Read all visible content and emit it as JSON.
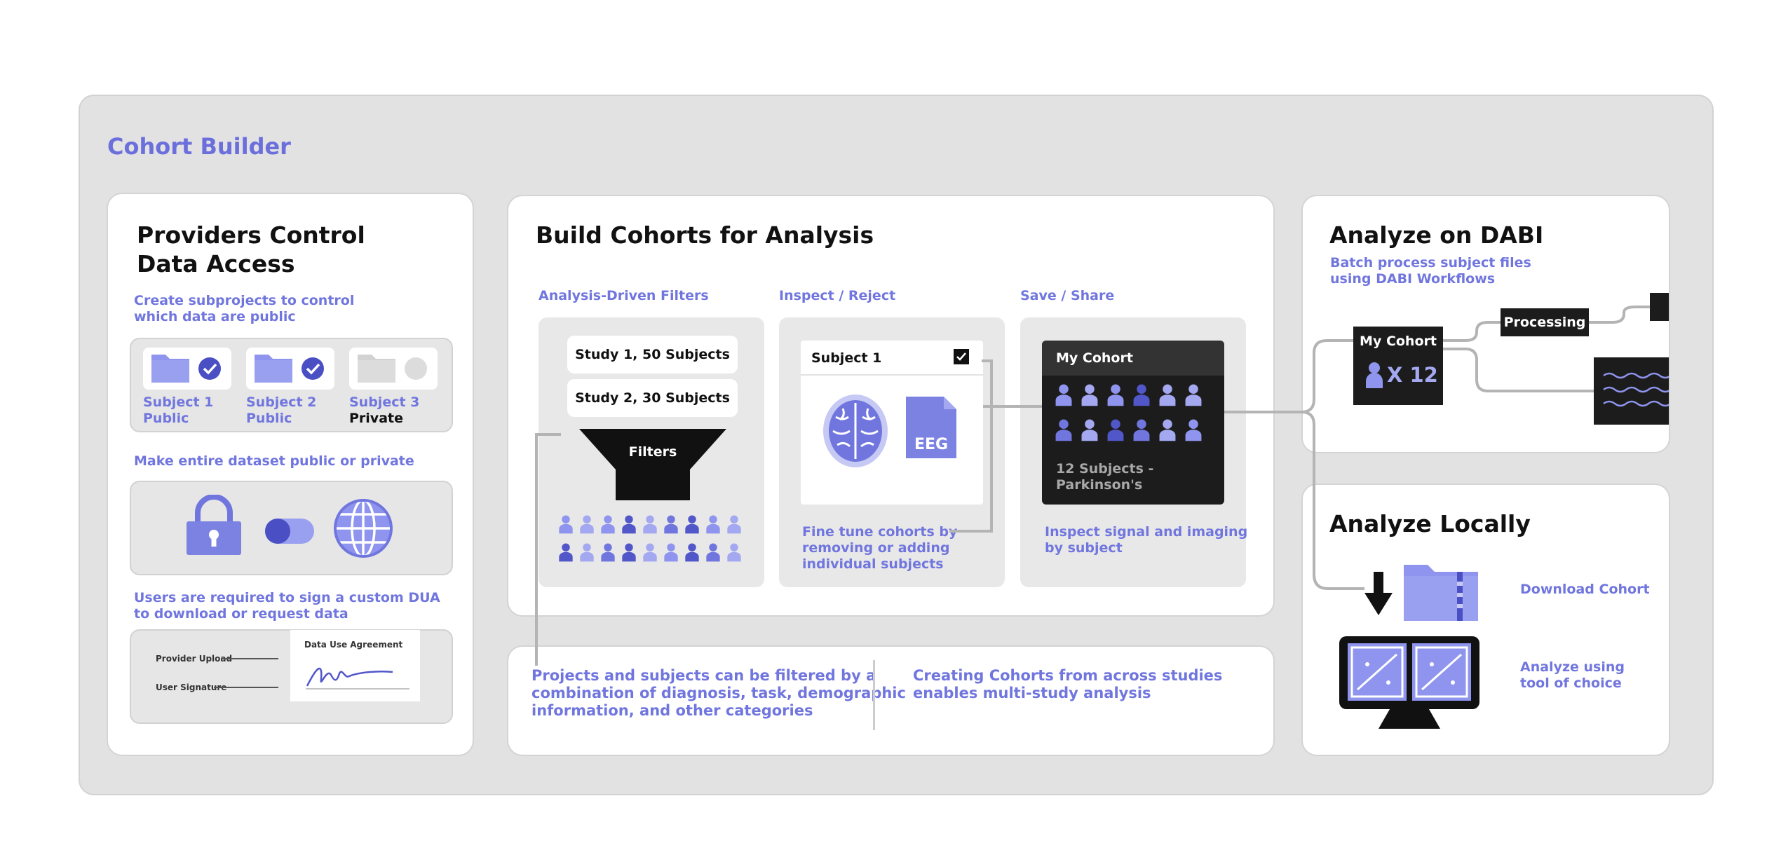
{
  "app_title": "Cohort Builder",
  "providers": {
    "title_line1": "Providers Control",
    "title_line2": "Data Access",
    "sub1_line1": "Create subprojects to control",
    "sub1_line2": "which data are public",
    "subjects": [
      {
        "name": "Subject 1",
        "status": "Public"
      },
      {
        "name": "Subject 2",
        "status": "Public"
      },
      {
        "name": "Subject 3",
        "status": "Private"
      }
    ],
    "sub2": "Make entire dataset public or private",
    "sub3_line1": "Users are required to sign a custom DUA",
    "sub3_line2": "to download or request data",
    "dua_title": "Data Use Agreement",
    "provider_upload": "Provider Upload",
    "user_signature": "User Signature"
  },
  "build": {
    "title": "Build Cohorts for Analysis",
    "col1_label": "Analysis-Driven Filters",
    "col2_label": "Inspect / Reject",
    "col3_label": "Save / Share",
    "study1": "Study 1, 50 Subjects",
    "study2": "Study 2, 30 Subjects",
    "filters": "Filters",
    "subject_card_title": "Subject 1",
    "eeg": "EEG",
    "inspect_line1": "Fine tune cohorts by",
    "inspect_line2": "removing or adding",
    "inspect_line3": "individual subjects",
    "cohort_title": "My Cohort",
    "cohort_sub_line1": "12 Subjects -",
    "cohort_sub_line2": "Parkinson's",
    "save_line1": "Inspect signal and imaging",
    "save_line2": "by subject",
    "bottom_left_line1": "Projects and subjects can be filtered by a",
    "bottom_left_line2": "combination of diagnosis, task, demographic",
    "bottom_left_line3": "information, and other categories",
    "bottom_right_line1": "Creating Cohorts from across studies",
    "bottom_right_line2": "enables multi-study analysis"
  },
  "dabi": {
    "title": "Analyze on DABI",
    "sub_line1": "Batch process subject files",
    "sub_line2": "using DABI Workflows",
    "cohort_label": "My Cohort",
    "cohort_count": "X 12",
    "processing": "Processing"
  },
  "local": {
    "title": "Analyze Locally",
    "download": "Download Cohort",
    "analyze_line1": "Analyze using",
    "analyze_line2": "tool of choice"
  },
  "colors": {
    "accent": "#6b6fdc",
    "accent_light": "#8f95ee",
    "dark": "#1c1c1c",
    "panel": "#e2e2e2"
  }
}
